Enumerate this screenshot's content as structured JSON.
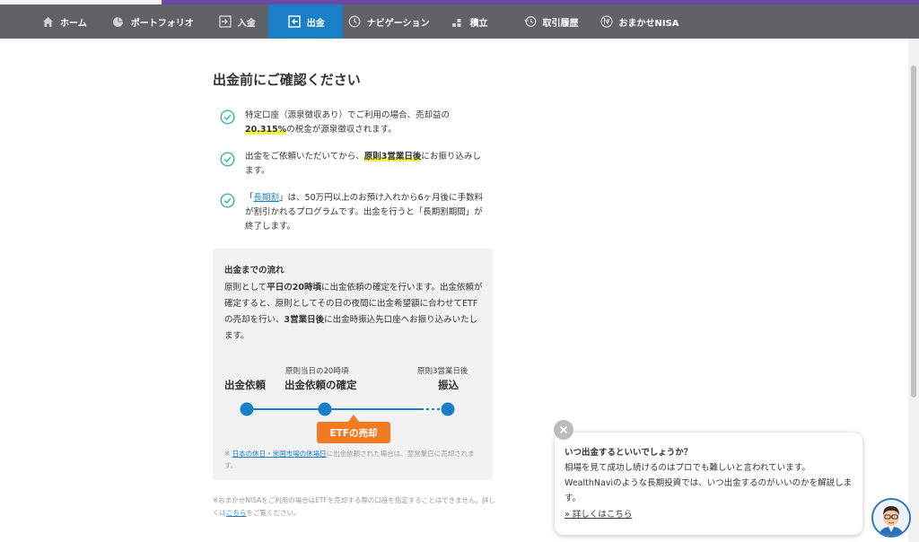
{
  "nav": {
    "items": [
      {
        "label": "ホーム",
        "icon": "home-icon"
      },
      {
        "label": "ポートフォリオ",
        "icon": "pie-chart-icon"
      },
      {
        "label": "入金",
        "icon": "deposit-icon"
      },
      {
        "label": "出金",
        "icon": "withdraw-icon",
        "active": true
      },
      {
        "label": "ナビゲーション",
        "icon": "compass-icon"
      },
      {
        "label": "積立",
        "icon": "stack-icon"
      },
      {
        "label": "取引履歴",
        "icon": "history-icon"
      },
      {
        "label": "おまかせNISA",
        "icon": "nisa-icon"
      }
    ],
    "active_color": "#1a7fc7",
    "bar_color": "#5f6368"
  },
  "main": {
    "title": "出金前にご確認ください",
    "checks": [
      {
        "pre": "特定口座（源泉徴収あり）でご利用の場合、売却益の",
        "highlight": "20.315%",
        "post": "の税金が源泉徴収されます。"
      },
      {
        "pre": "出金をご依頼いただいてから、",
        "highlight": "原則3営業日後",
        "post": "にお振り込みします。"
      },
      {
        "pre": "「",
        "link": "長期割",
        "post": "」は、50万円以上のお預け入れから6ヶ月後に手数料が割引かれるプログラムです。出金を行うと「長期割期間」が終了します。"
      }
    ]
  },
  "flow": {
    "title": "出金までの流れ",
    "desc_1": "原則として",
    "desc_b1": "平日の20時頃",
    "desc_2": "に出金依頼の確定を行います。出金依頼が確定すると、原則としてその日の夜間に出金希望額に合わせてETFの売却を行い、",
    "desc_b2": "3営業日後",
    "desc_3": "に出金時振込先口座へお振り込みいたします。",
    "step1_main": "出金依頼",
    "step2_sub": "原則当日の20時頃",
    "step2_main": "出金依頼の確定",
    "step3_sub": "原則3営業日後",
    "step3_main": "振込",
    "etf_label": "ETFの売却",
    "note_prefix": "※ ",
    "note_link": "日本の休日・米国市場の休場日",
    "note_suffix": "に出金依頼された場合は、翌営業日に売却されます。"
  },
  "nisa_note": {
    "text": "※おまかせNISAをご利用の場合はETFを売却する際の口座を指定することはできません。詳しくは",
    "link": "こちら",
    "suffix": "をご覧ください。"
  },
  "popup": {
    "title": "いつ出金するといいでしょうか？",
    "body": "相場を見て成功し続けるのはプロでも難しいと言われています。WealthNaviのような長期投資では、いつ出金するのがいいのかを解説します。",
    "link": "» 詳しくはこちら"
  },
  "colors": {
    "timeline": "#1a7fc7",
    "badge": "#f07b22",
    "highlight": "#f5f14a"
  }
}
